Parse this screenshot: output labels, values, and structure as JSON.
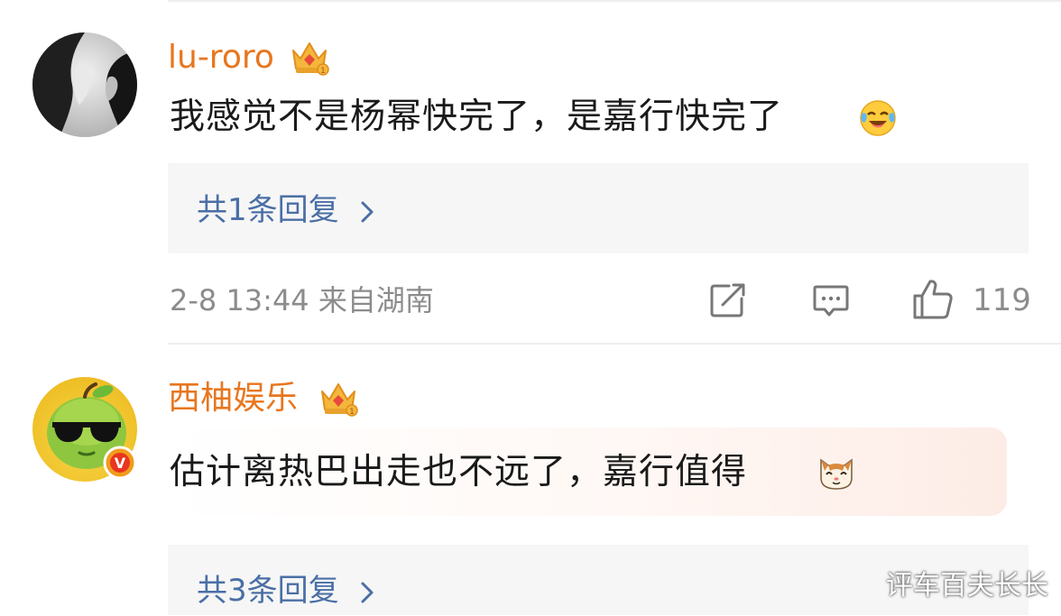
{
  "comments": [
    {
      "username": "lu-roro",
      "text": "我感觉不是杨幂快完了，是嘉行快完了",
      "emoji": "laughing-crying-emoji",
      "replies_label": "共1条回复",
      "meta": "2-8 13:44 来自湖南",
      "likes": "119"
    },
    {
      "username": "西柚娱乐",
      "text": "估计离热巴出走也不远了，嘉行值得",
      "emoji": "cat-face-emoji",
      "verified_badge": "V",
      "replies_label": "共3条回复"
    }
  ],
  "watermark": "评车百夫长长",
  "colors": {
    "username": "#e8761e",
    "reply_link": "#4a6fa5",
    "meta": "#8c8c8c",
    "reply_bg": "#f6f6f6"
  },
  "icons": [
    "crown-icon",
    "chevron-right-icon",
    "share-icon",
    "comment-icon",
    "like-icon",
    "verified-badge-icon"
  ]
}
